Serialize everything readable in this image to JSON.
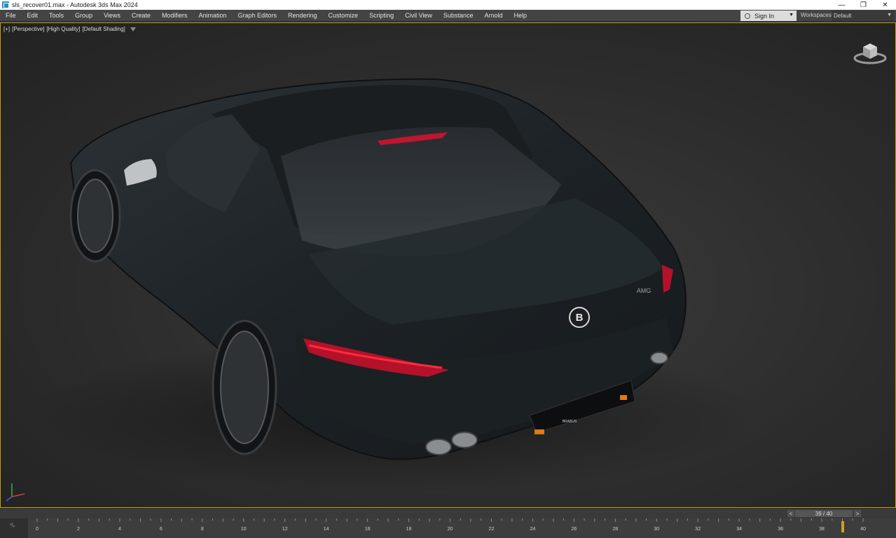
{
  "window": {
    "title": "sls_recover01.max - Autodesk 3ds Max 2024",
    "controls": {
      "minimize": "—",
      "maximize": "❐",
      "close": "✕"
    }
  },
  "menu": {
    "items": [
      "File",
      "Edit",
      "Tools",
      "Group",
      "Views",
      "Create",
      "Modifiers",
      "Animation",
      "Graph Editors",
      "Rendering",
      "Customize",
      "Scripting",
      "Civil View",
      "Substance",
      "Arnold",
      "Help"
    ],
    "sign_in": "Sign In",
    "workspaces_label": "Workspaces:",
    "workspace_value": "Default"
  },
  "viewport": {
    "labels": [
      "[+]",
      "[Perspective]",
      "[High Quality]",
      "[Default Shading]"
    ],
    "badge_letter": "B",
    "trunk_text": "AMG",
    "plate_text": "BRABUS"
  },
  "timeline": {
    "frame_indicator": "39 / 40",
    "prev": "<",
    "next": ">",
    "current_frame": 39,
    "total_frames": 40,
    "corner_label": "⁰/ₓ",
    "tick_labels": [
      "0",
      "2",
      "4",
      "6",
      "8",
      "10",
      "12",
      "14",
      "16",
      "18",
      "20",
      "22",
      "24",
      "26",
      "28",
      "30",
      "32",
      "34",
      "36",
      "38",
      "40"
    ]
  },
  "colors": {
    "viewport_border": "#c8a000",
    "time_marker": "#c9a227",
    "menubar": "#444444"
  }
}
